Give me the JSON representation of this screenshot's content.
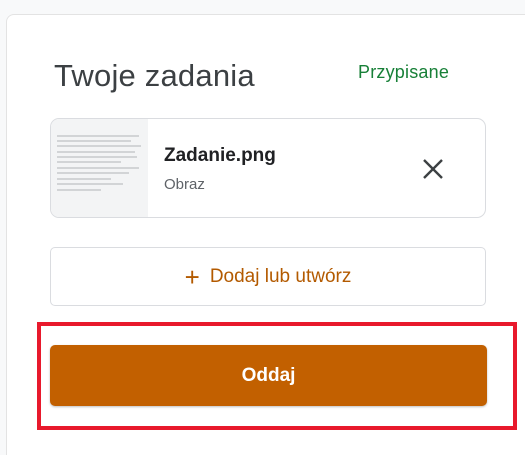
{
  "work_panel": {
    "title": "Twoje zadania",
    "status": "Przypisane",
    "status_color": "#188038",
    "attachment": {
      "file_name": "Zadanie.png",
      "file_type": "Obraz",
      "thumbnail_icon": "document-thumbnail",
      "remove_icon": "close-icon"
    },
    "add_button": {
      "icon": "plus-icon",
      "label": "Dodaj lub utwórz"
    },
    "submit_button": {
      "label": "Oddaj",
      "color": "#c26000"
    },
    "highlight_color": "#e8192c"
  }
}
